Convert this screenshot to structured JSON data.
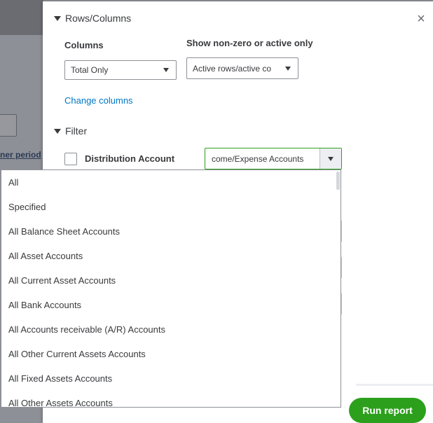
{
  "background": {
    "partial_link": "ner period"
  },
  "panel": {
    "rows_columns": {
      "section_label": "Rows/Columns",
      "columns_label": "Columns",
      "columns_value": "Total Only",
      "show_label": "Show non-zero or active only",
      "show_value": "Active rows/active co",
      "change_columns_link": "Change columns"
    },
    "filter": {
      "section_label": "Filter",
      "distribution_label": "Distribution Account",
      "distribution_checked": false,
      "distribution_value": "come/Expense Accounts"
    },
    "run_report_label": "Run report"
  },
  "dropdown": {
    "options": [
      "All",
      "Specified",
      "All Balance Sheet Accounts",
      "All Asset Accounts",
      "All Current Asset Accounts",
      "All Bank Accounts",
      "All Accounts receivable (A/R) Accounts",
      "All Other Current Assets Accounts",
      "All Fixed Assets Accounts",
      "All Other Assets Accounts"
    ]
  },
  "colors": {
    "accent_green": "#2ca01c",
    "link_blue": "#0077c5",
    "text": "#393a3d"
  }
}
